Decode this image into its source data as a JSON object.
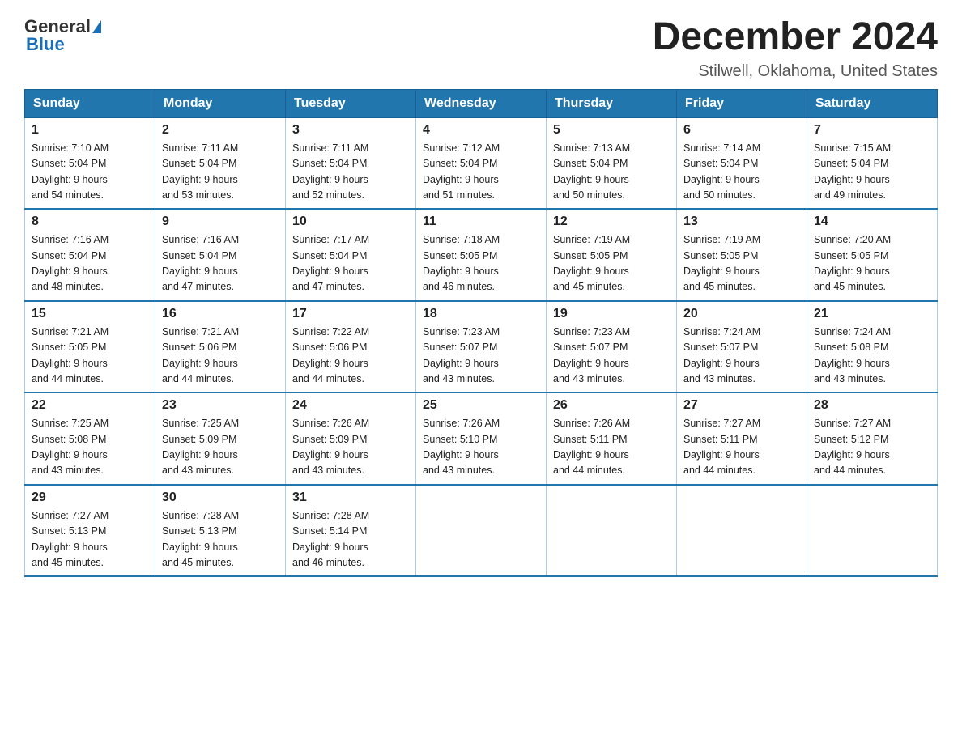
{
  "header": {
    "logo_general": "General",
    "logo_blue": "Blue",
    "title": "December 2024",
    "subtitle": "Stilwell, Oklahoma, United States"
  },
  "weekdays": [
    "Sunday",
    "Monday",
    "Tuesday",
    "Wednesday",
    "Thursday",
    "Friday",
    "Saturday"
  ],
  "weeks": [
    [
      {
        "day": "1",
        "sunrise": "7:10 AM",
        "sunset": "5:04 PM",
        "daylight": "9 hours and 54 minutes."
      },
      {
        "day": "2",
        "sunrise": "7:11 AM",
        "sunset": "5:04 PM",
        "daylight": "9 hours and 53 minutes."
      },
      {
        "day": "3",
        "sunrise": "7:11 AM",
        "sunset": "5:04 PM",
        "daylight": "9 hours and 52 minutes."
      },
      {
        "day": "4",
        "sunrise": "7:12 AM",
        "sunset": "5:04 PM",
        "daylight": "9 hours and 51 minutes."
      },
      {
        "day": "5",
        "sunrise": "7:13 AM",
        "sunset": "5:04 PM",
        "daylight": "9 hours and 50 minutes."
      },
      {
        "day": "6",
        "sunrise": "7:14 AM",
        "sunset": "5:04 PM",
        "daylight": "9 hours and 50 minutes."
      },
      {
        "day": "7",
        "sunrise": "7:15 AM",
        "sunset": "5:04 PM",
        "daylight": "9 hours and 49 minutes."
      }
    ],
    [
      {
        "day": "8",
        "sunrise": "7:16 AM",
        "sunset": "5:04 PM",
        "daylight": "9 hours and 48 minutes."
      },
      {
        "day": "9",
        "sunrise": "7:16 AM",
        "sunset": "5:04 PM",
        "daylight": "9 hours and 47 minutes."
      },
      {
        "day": "10",
        "sunrise": "7:17 AM",
        "sunset": "5:04 PM",
        "daylight": "9 hours and 47 minutes."
      },
      {
        "day": "11",
        "sunrise": "7:18 AM",
        "sunset": "5:05 PM",
        "daylight": "9 hours and 46 minutes."
      },
      {
        "day": "12",
        "sunrise": "7:19 AM",
        "sunset": "5:05 PM",
        "daylight": "9 hours and 45 minutes."
      },
      {
        "day": "13",
        "sunrise": "7:19 AM",
        "sunset": "5:05 PM",
        "daylight": "9 hours and 45 minutes."
      },
      {
        "day": "14",
        "sunrise": "7:20 AM",
        "sunset": "5:05 PM",
        "daylight": "9 hours and 45 minutes."
      }
    ],
    [
      {
        "day": "15",
        "sunrise": "7:21 AM",
        "sunset": "5:05 PM",
        "daylight": "9 hours and 44 minutes."
      },
      {
        "day": "16",
        "sunrise": "7:21 AM",
        "sunset": "5:06 PM",
        "daylight": "9 hours and 44 minutes."
      },
      {
        "day": "17",
        "sunrise": "7:22 AM",
        "sunset": "5:06 PM",
        "daylight": "9 hours and 44 minutes."
      },
      {
        "day": "18",
        "sunrise": "7:23 AM",
        "sunset": "5:07 PM",
        "daylight": "9 hours and 43 minutes."
      },
      {
        "day": "19",
        "sunrise": "7:23 AM",
        "sunset": "5:07 PM",
        "daylight": "9 hours and 43 minutes."
      },
      {
        "day": "20",
        "sunrise": "7:24 AM",
        "sunset": "5:07 PM",
        "daylight": "9 hours and 43 minutes."
      },
      {
        "day": "21",
        "sunrise": "7:24 AM",
        "sunset": "5:08 PM",
        "daylight": "9 hours and 43 minutes."
      }
    ],
    [
      {
        "day": "22",
        "sunrise": "7:25 AM",
        "sunset": "5:08 PM",
        "daylight": "9 hours and 43 minutes."
      },
      {
        "day": "23",
        "sunrise": "7:25 AM",
        "sunset": "5:09 PM",
        "daylight": "9 hours and 43 minutes."
      },
      {
        "day": "24",
        "sunrise": "7:26 AM",
        "sunset": "5:09 PM",
        "daylight": "9 hours and 43 minutes."
      },
      {
        "day": "25",
        "sunrise": "7:26 AM",
        "sunset": "5:10 PM",
        "daylight": "9 hours and 43 minutes."
      },
      {
        "day": "26",
        "sunrise": "7:26 AM",
        "sunset": "5:11 PM",
        "daylight": "9 hours and 44 minutes."
      },
      {
        "day": "27",
        "sunrise": "7:27 AM",
        "sunset": "5:11 PM",
        "daylight": "9 hours and 44 minutes."
      },
      {
        "day": "28",
        "sunrise": "7:27 AM",
        "sunset": "5:12 PM",
        "daylight": "9 hours and 44 minutes."
      }
    ],
    [
      {
        "day": "29",
        "sunrise": "7:27 AM",
        "sunset": "5:13 PM",
        "daylight": "9 hours and 45 minutes."
      },
      {
        "day": "30",
        "sunrise": "7:28 AM",
        "sunset": "5:13 PM",
        "daylight": "9 hours and 45 minutes."
      },
      {
        "day": "31",
        "sunrise": "7:28 AM",
        "sunset": "5:14 PM",
        "daylight": "9 hours and 46 minutes."
      },
      null,
      null,
      null,
      null
    ]
  ],
  "labels": {
    "sunrise_prefix": "Sunrise: ",
    "sunset_prefix": "Sunset: ",
    "daylight_prefix": "Daylight: "
  }
}
